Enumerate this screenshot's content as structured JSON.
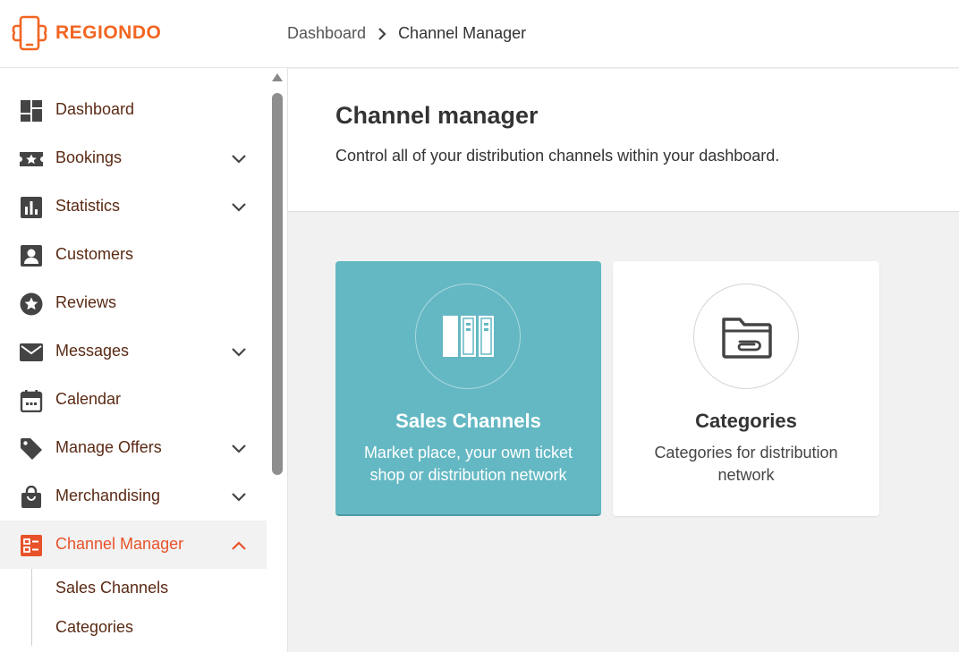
{
  "brand": {
    "name": "REGIONDO",
    "color": "#f26522"
  },
  "breadcrumb": {
    "parent": "Dashboard",
    "current": "Channel Manager"
  },
  "sidebar": {
    "items": [
      {
        "label": "Dashboard",
        "icon": "dashboard-icon",
        "expandable": false
      },
      {
        "label": "Bookings",
        "icon": "ticket-star-icon",
        "expandable": true
      },
      {
        "label": "Statistics",
        "icon": "bar-chart-icon",
        "expandable": true
      },
      {
        "label": "Customers",
        "icon": "person-icon",
        "expandable": false
      },
      {
        "label": "Reviews",
        "icon": "star-icon",
        "expandable": false
      },
      {
        "label": "Messages",
        "icon": "envelope-icon",
        "expandable": true
      },
      {
        "label": "Calendar",
        "icon": "calendar-icon",
        "expandable": false
      },
      {
        "label": "Manage Offers",
        "icon": "tag-icon",
        "expandable": true
      },
      {
        "label": "Merchandising",
        "icon": "shopping-bag-icon",
        "expandable": true
      },
      {
        "label": "Channel Manager",
        "icon": "channel-manager-icon",
        "expandable": true,
        "active": true
      }
    ],
    "subitems": [
      {
        "label": "Sales Channels"
      },
      {
        "label": "Categories"
      }
    ],
    "active_color": "#e8522a"
  },
  "header": {
    "title": "Channel manager",
    "subtitle": "Control all of your distribution channels within your dashboard."
  },
  "cards": [
    {
      "title": "Sales Channels",
      "description": "Market place, your own ticket shop or distribution network",
      "icon": "binders-icon",
      "background": "#64b8c3"
    },
    {
      "title": "Categories",
      "description": "Categories for distribution network",
      "icon": "folder-paperclip-icon",
      "background": "#ffffff"
    }
  ]
}
